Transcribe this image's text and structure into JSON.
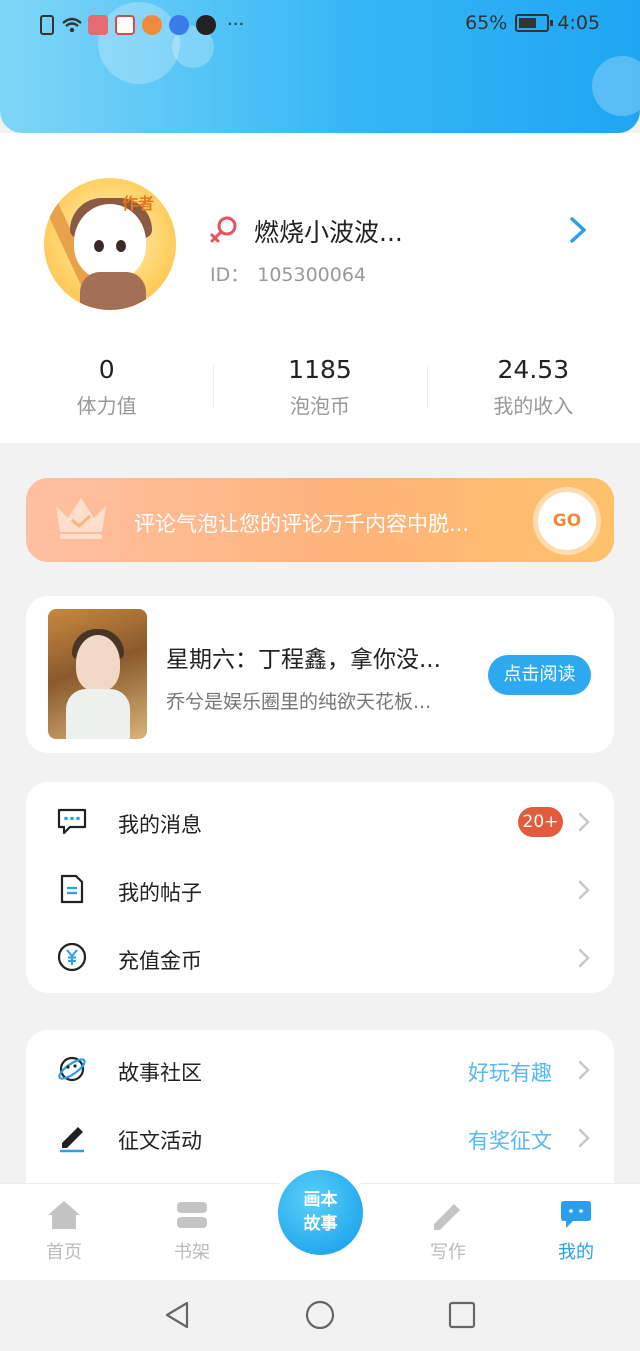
{
  "status_bar": {
    "battery": "65%",
    "battery_level": 0.65,
    "time": "4:05"
  },
  "profile": {
    "avatar_tag": "作者",
    "username": "燃烧小波波...",
    "id_label": "ID：",
    "id_value": "105300064"
  },
  "stats": [
    {
      "value": "0",
      "label": "体力值"
    },
    {
      "value": "1185",
      "label": "泡泡币"
    },
    {
      "value": "24.53",
      "label": "我的收入"
    }
  ],
  "promo": {
    "text": "评论气泡让您的评论万千内容中脱...",
    "go_label": "GO"
  },
  "book": {
    "title": "星期六：丁程鑫，拿你没...",
    "desc": "乔兮是娱乐圈里的纯欲天花板...",
    "read_label": "点击阅读"
  },
  "menu1": [
    {
      "label": "我的消息",
      "icon": "message-icon",
      "badge": "20+"
    },
    {
      "label": "我的帖子",
      "icon": "document-icon"
    },
    {
      "label": "充值金币",
      "icon": "yuan-coin-icon"
    }
  ],
  "menu2": [
    {
      "label": "故事社区",
      "icon": "planet-icon",
      "extra": "好玩有趣"
    },
    {
      "label": "征文活动",
      "icon": "pen-icon",
      "extra": "有奖征文"
    }
  ],
  "tabs": [
    {
      "label": "首页",
      "icon": "home-icon"
    },
    {
      "label": "书架",
      "icon": "bookshelf-icon"
    },
    {
      "label": "写作",
      "icon": "write-icon"
    },
    {
      "label": "我的",
      "icon": "profile-icon",
      "active": true
    }
  ],
  "center_tab": {
    "line1": "画本",
    "line2": "故事"
  },
  "colors": {
    "accent": "#2ea8ee",
    "badge": "#e25b3d",
    "promo": "#ffb37a"
  }
}
